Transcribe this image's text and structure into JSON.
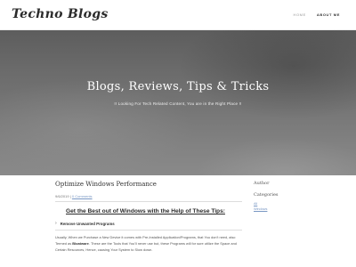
{
  "header": {
    "logo": "Techno Blogs",
    "nav": [
      {
        "label": "HOME"
      },
      {
        "label": "ABOUT ME"
      }
    ]
  },
  "hero": {
    "title": "Blogs, Reviews, Tips & Tricks",
    "subtitle": "!! Looking For Tech Related Content, You are in the Right Place !!"
  },
  "post": {
    "title": "Optimize Windows Performance",
    "date": "9/6/2019",
    "comments": "0 Comments",
    "headline": "Get the Best out of Windows with the Help of These Tips:",
    "section_label": "Remove Unwanted Programs",
    "paragraph_1": "Usually, When we Purchase a New Device it comes with Pre-Installed Application/Programs, that You don't need, also Termed as ",
    "paragraph_bold": "Bloatware",
    "paragraph_2": ". These are the Tools that You'll never use but, these Programs will for sure utilize the Space and Certain Resources, Hence, causing Your System to Slow down."
  },
  "sidebar": {
    "author_heading": "Author",
    "categories_heading": "Categories",
    "links": [
      "All",
      "Windows"
    ]
  },
  "colors": {
    "link": "#7a98c4",
    "text": "#444444",
    "hero_bg": "#6c6c6c"
  }
}
